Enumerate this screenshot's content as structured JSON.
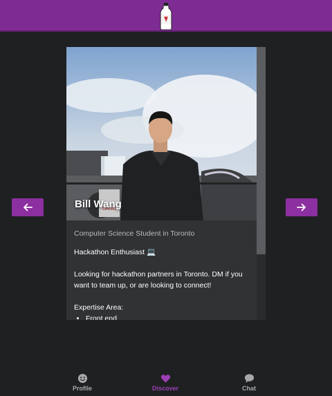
{
  "colors": {
    "brand": "#7e2c93",
    "accent": "#8c2fa0",
    "active_tab": "#9c3fb5",
    "background": "#1f2022",
    "card": "#303234"
  },
  "header": {
    "logo_icon": "bottle-logo-icon"
  },
  "navigation": {
    "prev_icon": "arrow-left-icon",
    "next_icon": "arrow-right-icon"
  },
  "profile": {
    "name": "Bill Wang",
    "subtitle": "Computer Science Student in Toronto",
    "headline": "Hackathon Enthusiast 💻",
    "bio": "Looking for hackathon partners in Toronto. DM if you want to team up, or are looking to connect!",
    "expertise_label": "Expertise Area:",
    "expertise": [
      "Front end"
    ]
  },
  "bottom_nav": {
    "tabs": [
      {
        "label": "Profile",
        "icon": "smiley-icon",
        "active": false
      },
      {
        "label": "Discover",
        "icon": "heart-icon",
        "active": true
      },
      {
        "label": "Chat",
        "icon": "chat-bubble-icon",
        "active": false
      }
    ]
  }
}
